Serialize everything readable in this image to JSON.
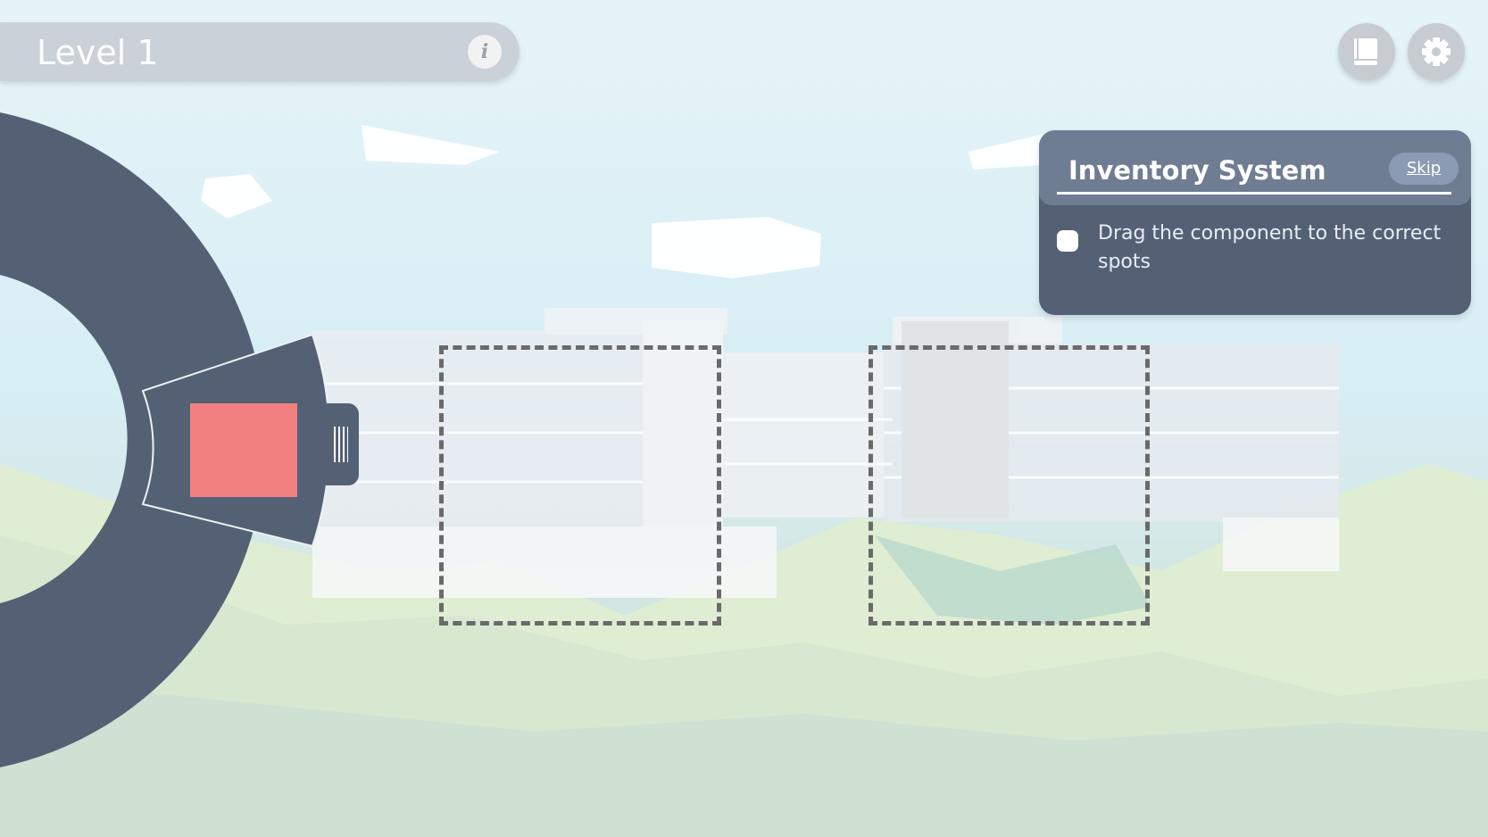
{
  "level": {
    "title": "Level 1",
    "info_icon": "i"
  },
  "top_buttons": {
    "book_icon": "book-icon",
    "settings_icon": "gear-icon"
  },
  "panel": {
    "title": "Inventory System",
    "skip_label": "Skip",
    "tasks": [
      {
        "text": "Drag the component to the correct spots",
        "done": false
      }
    ]
  },
  "inventory": {
    "component_color": "#f28080",
    "ring_color": "#546175"
  },
  "colors": {
    "panel_bg": "#546175",
    "panel_header": "#6f7d93"
  }
}
